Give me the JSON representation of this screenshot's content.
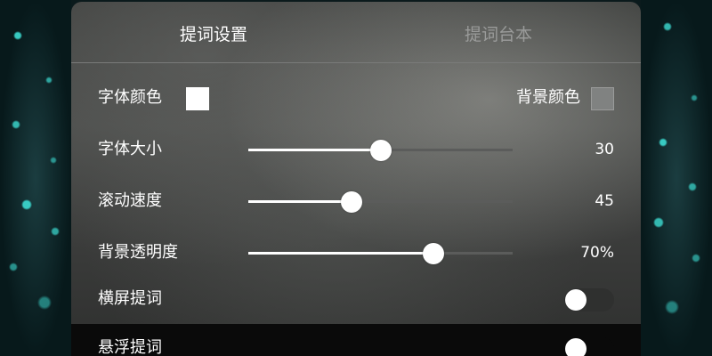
{
  "tabs": [
    {
      "label": "提词设置",
      "active": true
    },
    {
      "label": "提词台本",
      "active": false
    }
  ],
  "font_color": {
    "label": "字体颜色",
    "swatch_color": "#ffffff"
  },
  "background_color": {
    "label": "背景颜色",
    "swatch_color": "#808281"
  },
  "font_size": {
    "label": "字体大小",
    "value": "30",
    "level": 0.5
  },
  "scroll_speed": {
    "label": "滚动速度",
    "value": "45",
    "level": 0.39
  },
  "bg_opacity": {
    "label": "背景透明度",
    "value": "70%",
    "level": 0.7
  },
  "landscape": {
    "label": "横屏提词",
    "enabled": false
  },
  "floating": {
    "label": "悬浮提词",
    "enabled": false
  },
  "colors": {
    "accent": "#ffffff",
    "track": "#5b5c5b"
  }
}
